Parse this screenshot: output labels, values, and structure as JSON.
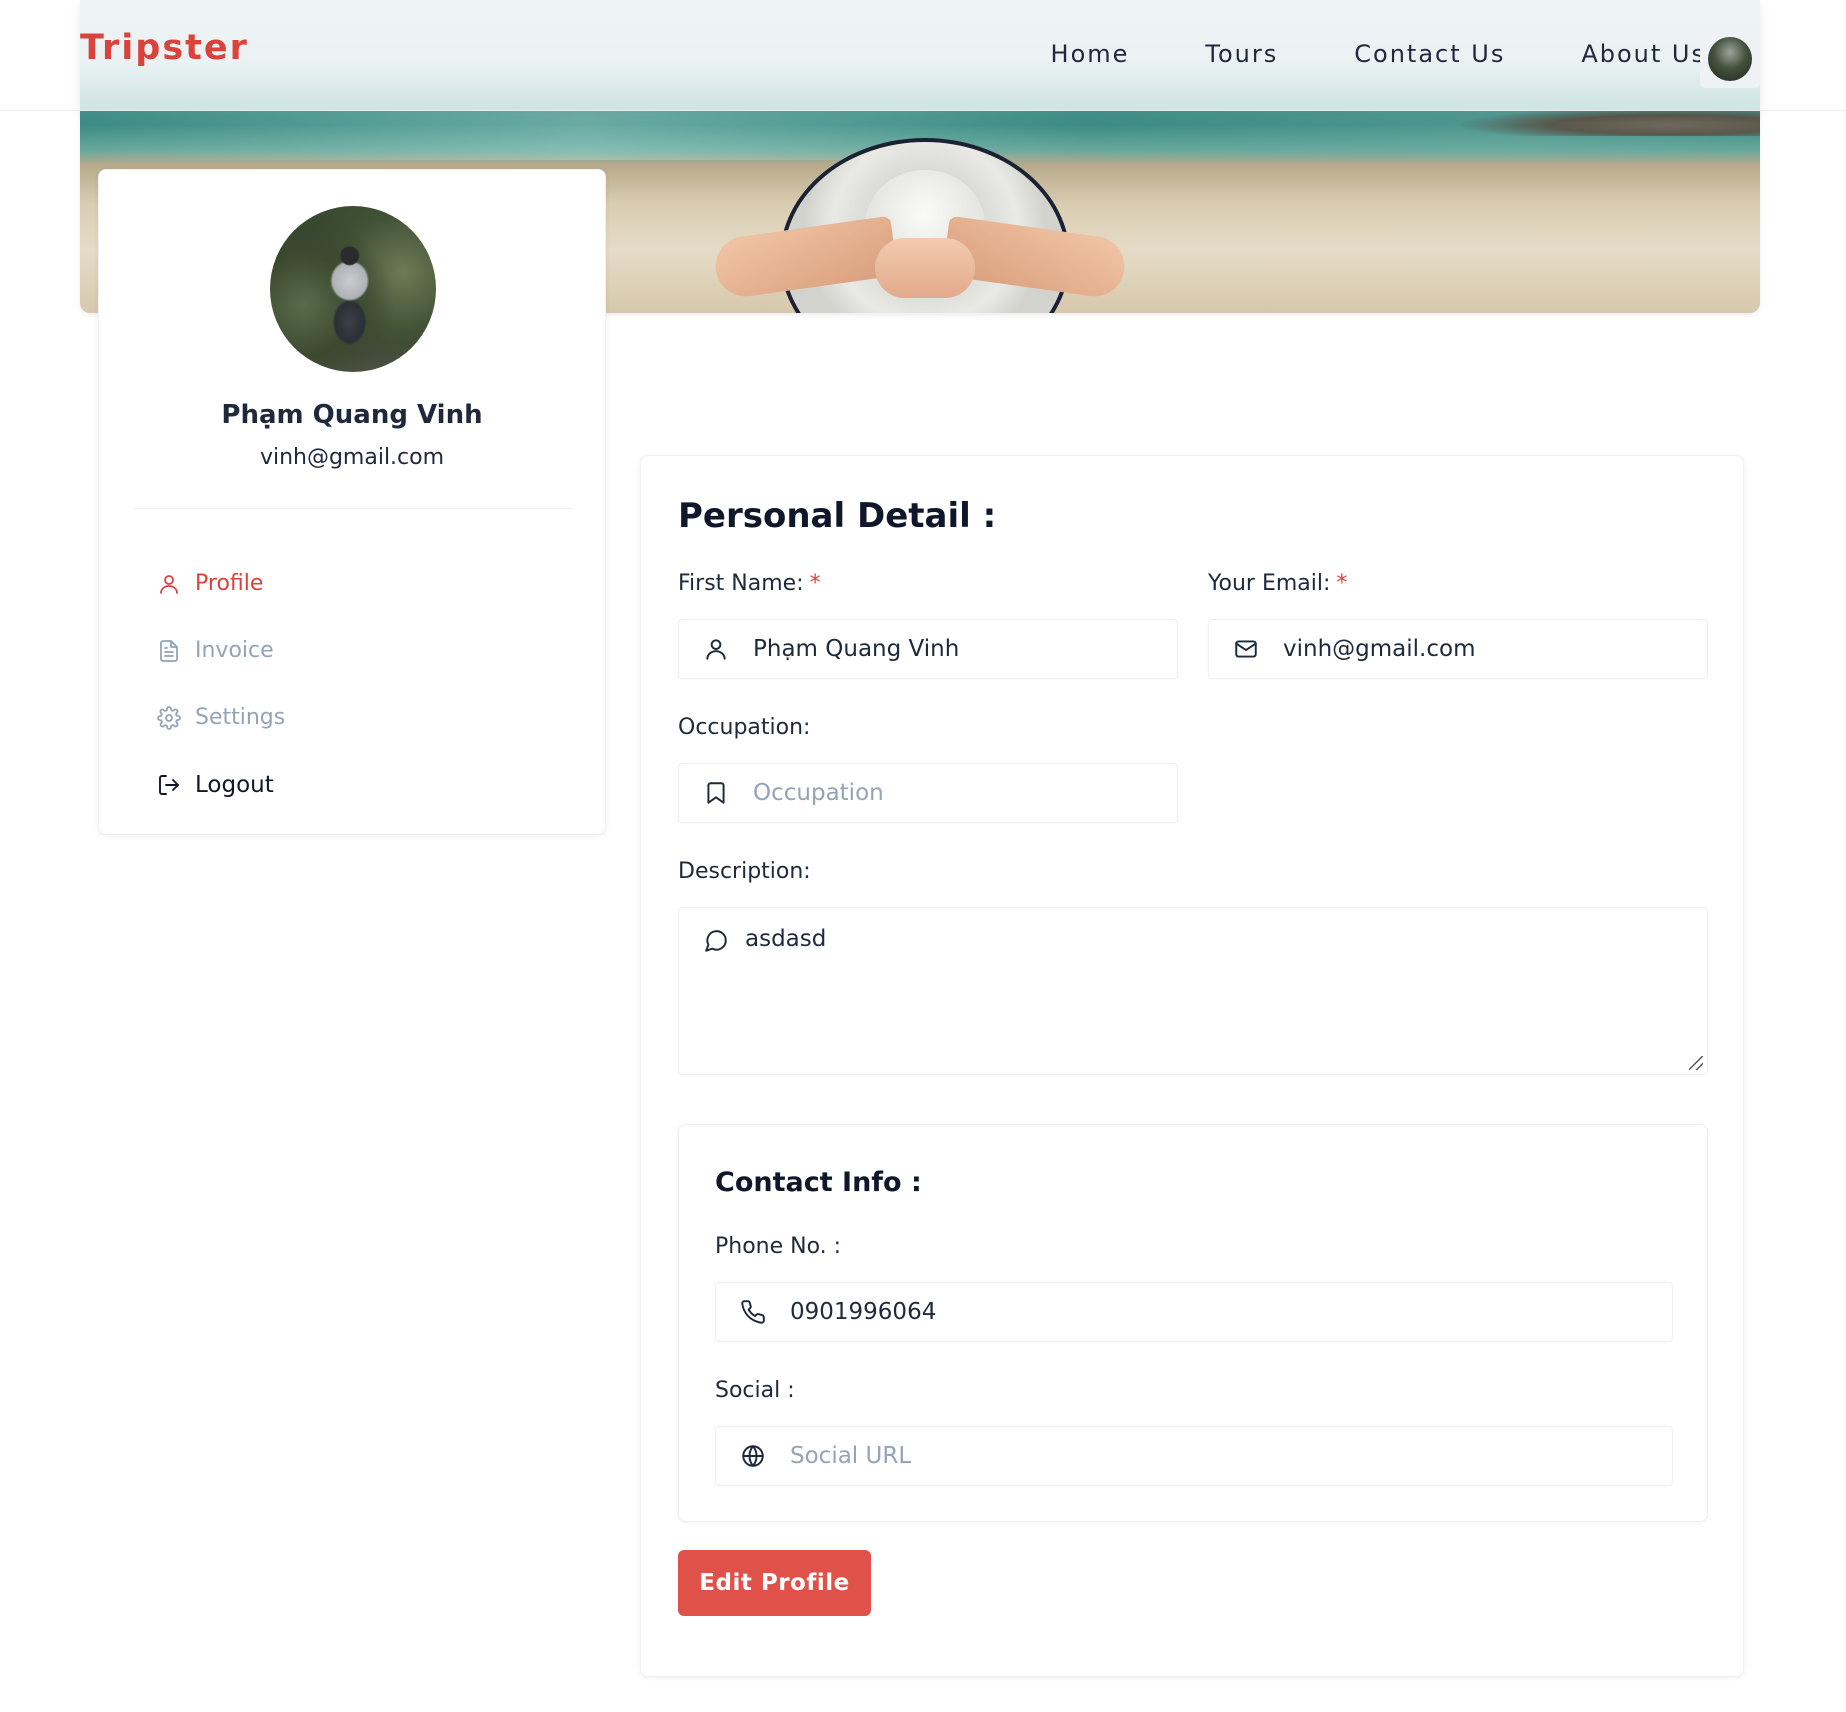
{
  "header": {
    "logo": "Tripster",
    "nav": [
      {
        "label": "Home"
      },
      {
        "label": "Tours"
      },
      {
        "label": "Contact Us"
      },
      {
        "label": "About Us"
      }
    ]
  },
  "sidebar": {
    "name": "Phạm Quang Vinh",
    "email": "vinh@gmail.com",
    "menu": [
      {
        "label": "Profile",
        "icon": "user-icon",
        "active": true
      },
      {
        "label": "Invoice",
        "icon": "file-icon"
      },
      {
        "label": "Settings",
        "icon": "gear-icon"
      },
      {
        "label": "Logout",
        "icon": "logout-icon"
      }
    ]
  },
  "form": {
    "title": "Personal Detail :",
    "first_name": {
      "label": "First Name:",
      "required_mark": "*",
      "value": "Phạm Quang Vinh"
    },
    "email": {
      "label": "Your Email:",
      "required_mark": "*",
      "value": "vinh@gmail.com"
    },
    "occupation": {
      "label": "Occupation:",
      "value": "",
      "placeholder": "Occupation"
    },
    "description": {
      "label": "Description:",
      "value": "asdasd"
    },
    "contact": {
      "title": "Contact Info :",
      "phone": {
        "label": "Phone No. :",
        "value": "0901996064"
      },
      "social": {
        "label": "Social :",
        "value": "",
        "placeholder": "Social URL"
      }
    },
    "submit_label": "Edit Profile"
  },
  "colors": {
    "accent": "#d9433b",
    "button": "#e05149",
    "muted": "#94a3b8",
    "text": "#1e293b"
  }
}
